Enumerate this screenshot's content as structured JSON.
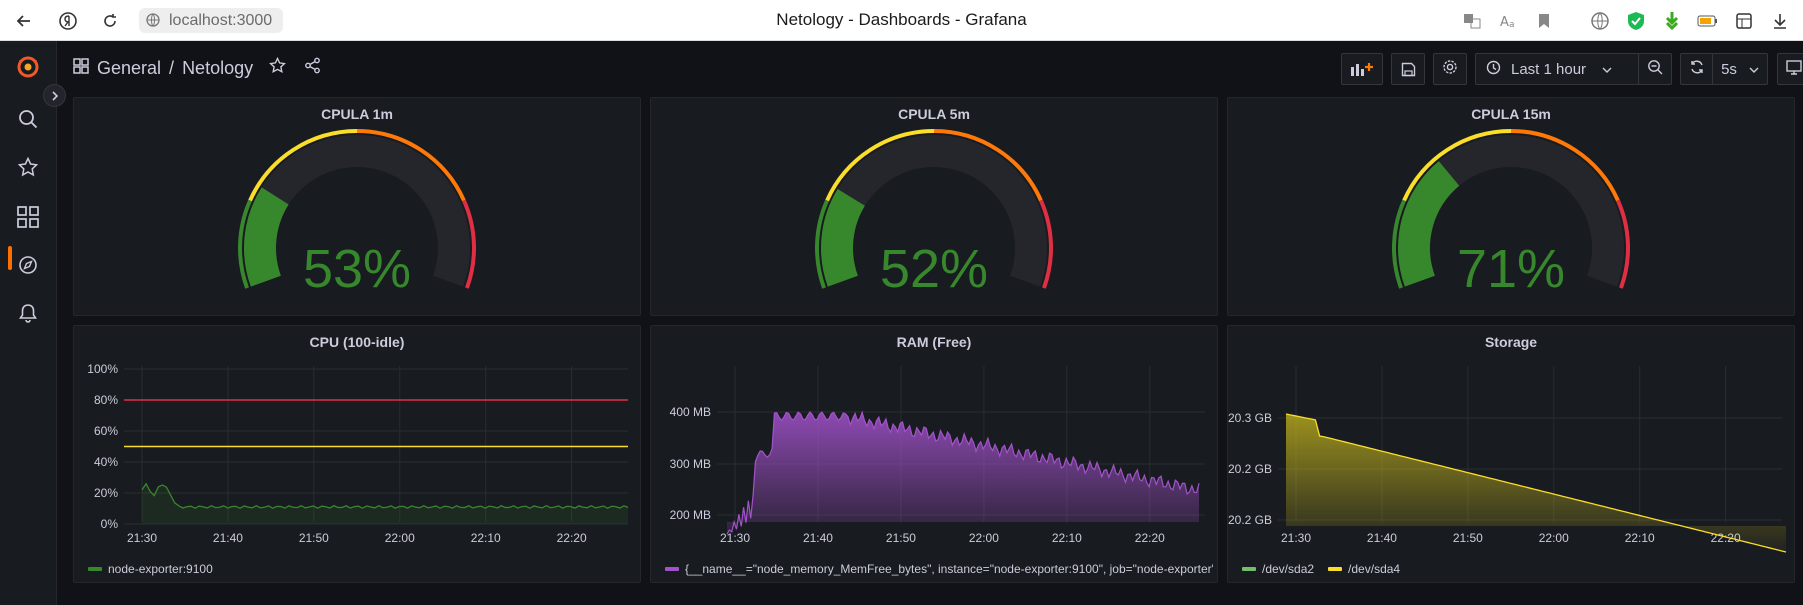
{
  "browser": {
    "url": "localhost:3000",
    "tab_title": "Netology - Dashboards - Grafana"
  },
  "breadcrumb": {
    "folder": "General",
    "separator": "/",
    "dashboard": "Netology"
  },
  "toolbar": {
    "time_range": "Last 1 hour",
    "refresh_interval": "5s"
  },
  "colors": {
    "green": "#37872d",
    "yellow": "#fade2a",
    "orange": "#ff780a",
    "red": "#e02f44",
    "purple": "#a352cc",
    "accent": "#ff6f00"
  },
  "gauges": [
    {
      "title": "CPULA 1m",
      "value": 53,
      "display": "53%"
    },
    {
      "title": "CPULA 5m",
      "value": 52,
      "display": "52%"
    },
    {
      "title": "CPULA 15m",
      "value": 71,
      "display": "71%"
    }
  ],
  "chart_data": [
    {
      "type": "line",
      "title": "CPU (100-idle)",
      "x": [
        "21:30",
        "21:40",
        "21:50",
        "22:00",
        "22:10",
        "22:20"
      ],
      "y_ticks": [
        "100%",
        "80%",
        "60%",
        "40%",
        "20%",
        "0%"
      ],
      "ylim": [
        0,
        100
      ],
      "thresholds": [
        {
          "value": 80,
          "color": "#e02f44"
        },
        {
          "value": 50,
          "color": "#fade2a"
        }
      ],
      "series": [
        {
          "name": "node-exporter:9100",
          "color": "#37872d",
          "values": [
            25,
            30,
            12,
            12,
            11,
            11,
            11,
            11
          ]
        }
      ],
      "legend": "bottom-left"
    },
    {
      "type": "area",
      "title": "RAM (Free)",
      "x": [
        "21:30",
        "21:40",
        "21:50",
        "22:00",
        "22:10",
        "22:20"
      ],
      "y_ticks": [
        "400 MB",
        "300 MB",
        "200 MB"
      ],
      "series": [
        {
          "name": "{__name__=\"node_memory_MemFree_bytes\", instance=\"node-exporter:9100\", job=\"node-exporter\"}",
          "color": "#a352cc",
          "values": [
            165,
            195,
            290,
            330,
            395,
            390,
            385,
            370,
            350,
            320,
            300,
            290,
            285,
            275,
            270,
            255
          ]
        }
      ],
      "legend": "bottom-left"
    },
    {
      "type": "area",
      "title": "Storage",
      "x": [
        "21:30",
        "21:40",
        "21:50",
        "22:00",
        "22:10",
        "22:20"
      ],
      "y_ticks": [
        "20.3 GB",
        "20.2 GB",
        "20.2 GB"
      ],
      "series": [
        {
          "name": "/dev/sda2",
          "color": "#73bf69",
          "values": []
        },
        {
          "name": "/dev/sda4",
          "color": "#fade2a",
          "values": [
            20.31,
            20.3,
            20.27,
            20.25,
            20.22,
            20.19,
            20.16,
            20.13,
            20.11
          ]
        }
      ],
      "legend": "bottom-left"
    }
  ]
}
